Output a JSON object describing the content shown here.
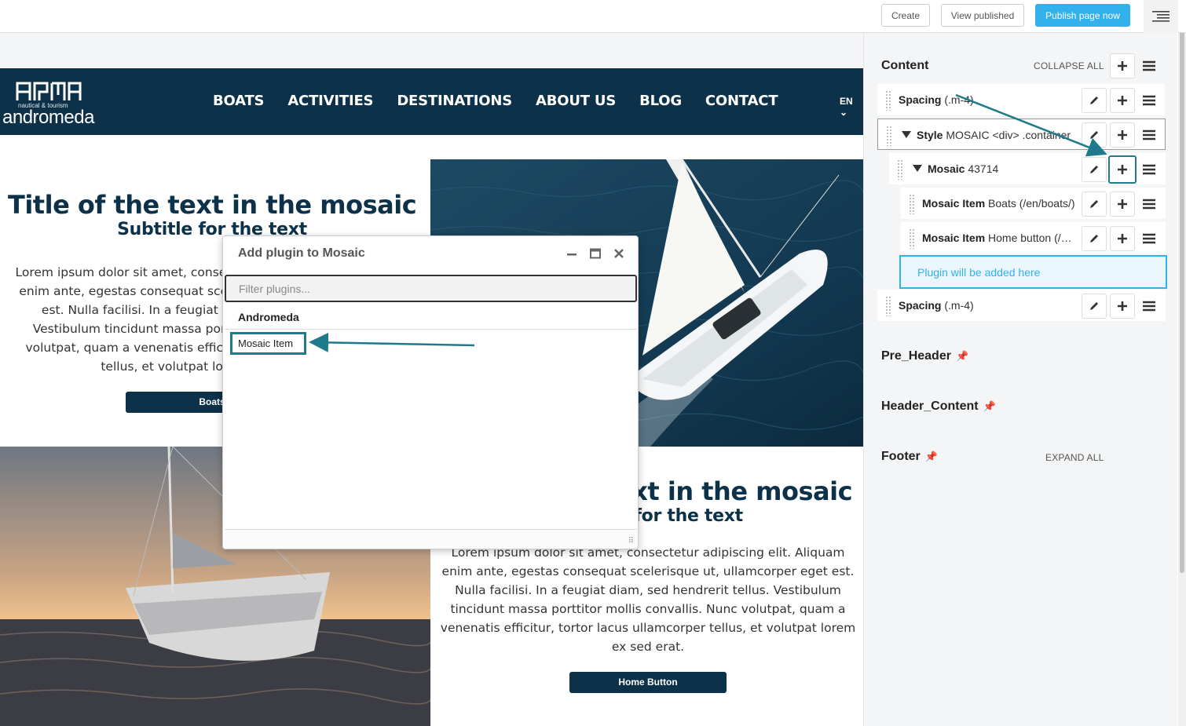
{
  "toolbar": {
    "create_label": "Create",
    "view_published_label": "View published",
    "publish_label": "Publish page now"
  },
  "site": {
    "logo_tagline": "nautical & tourism",
    "logo_name": "andromeda",
    "nav": [
      "BOATS",
      "ACTIVITIES",
      "DESTINATIONS",
      "ABOUT US",
      "BLOG",
      "CONTACT"
    ],
    "lang": "EN"
  },
  "mosaic": [
    {
      "title": "Title of the text in the mosaic",
      "subtitle": "Subtitle for the text",
      "body": "Lorem ipsum dolor sit amet, consectetur adipiscing elit. Aliquam enim ante, egestas consequat scelerisque ut, ullamcorper eget est. Nulla facilisi. In a feugiat diam, sed hendrerit tellus. Vestibulum tincidunt massa porttitor mollis convallis. Nunc volutpat, quam a venenatis efficitur, tortor lacus ullamcorper tellus, et volutpat lorem ex sed erat.",
      "button": "Boats"
    },
    {
      "title": "Title of the text in the mosaic",
      "subtitle": "Subtitle for the text",
      "body": "Lorem ipsum dolor sit amet, consectetur adipiscing elit. Aliquam enim ante, egestas consequat scelerisque ut, ullamcorper eget est. Nulla facilisi. In a feugiat diam, sed hendrerit tellus. Vestibulum tincidunt massa porttitor mollis convallis. Nunc volutpat, quam a venenatis efficitur, tortor lacus ullamcorper tellus, et volutpat lorem ex sed erat.",
      "button": "Home Button"
    }
  ],
  "modal": {
    "title": "Add plugin to Mosaic",
    "filter_placeholder": "Filter plugins...",
    "group": "Andromeda",
    "plugin": "Mosaic Item"
  },
  "sidebar": {
    "content_title": "Content",
    "collapse_all": "COLLAPSE ALL",
    "expand_all": "EXPAND ALL",
    "rows": [
      {
        "type": "Spacing",
        "detail": "(.m-4)"
      },
      {
        "type": "Style",
        "detail": "MOSAIC <div> .container"
      },
      {
        "type": "Mosaic",
        "detail": "43714"
      },
      {
        "type": "Mosaic Item",
        "detail": "Boats (/en/boats/)"
      },
      {
        "type": "Mosaic Item",
        "detail": "Home button (/en/)"
      },
      {
        "type": "Spacing",
        "detail": "(.m-4)"
      }
    ],
    "placeholder": "Plugin will be added here",
    "sections": [
      "Pre_Header",
      "Header_Content",
      "Footer"
    ]
  },
  "colors": {
    "brand_navy": "#0c3148",
    "accent_blue": "#33b1ea",
    "highlight_teal": "#1f7a8c"
  }
}
